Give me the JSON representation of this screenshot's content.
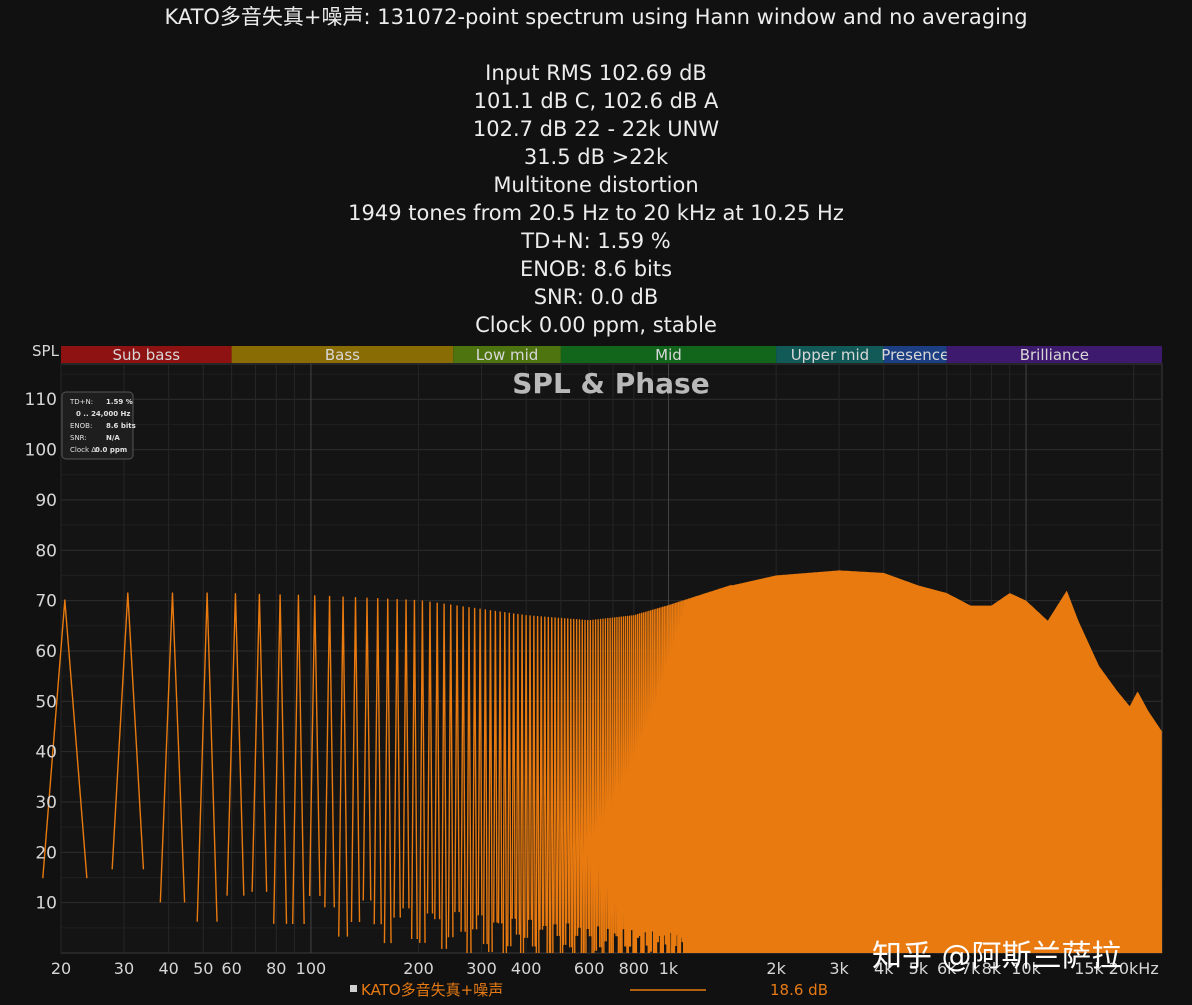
{
  "header": {
    "lines": [
      "KATO多音失真+噪声: 131072-point spectrum using Hann window and no averaging",
      "",
      "Input RMS 102.69 dB",
      "101.1 dB C, 102.6 dB A",
      "102.7 dB 22 - 22k UNW",
      "31.5 dB >22k",
      "Multitone distortion",
      "1949 tones from 20.5 Hz to 20 kHz at 10.25 Hz",
      "TD+N: 1.59 %",
      "ENOB: 8.6 bits",
      "SNR: 0.0 dB",
      "Clock 0.00 ppm, stable"
    ]
  },
  "chart_data": {
    "type": "line",
    "title": "SPL & Phase",
    "ylabel": "SPL",
    "xscale": "log",
    "xlim": [
      20,
      24000
    ],
    "ylim": [
      0,
      117
    ],
    "yticks": [
      10,
      20,
      30,
      40,
      50,
      60,
      70,
      80,
      90,
      100,
      110
    ],
    "xticks": [
      {
        "v": 20,
        "label": "20"
      },
      {
        "v": 30,
        "label": "30"
      },
      {
        "v": 40,
        "label": "40"
      },
      {
        "v": 50,
        "label": "50"
      },
      {
        "v": 60,
        "label": "60"
      },
      {
        "v": 80,
        "label": "80"
      },
      {
        "v": 100,
        "label": "100"
      },
      {
        "v": 200,
        "label": "200"
      },
      {
        "v": 300,
        "label": "300"
      },
      {
        "v": 400,
        "label": "400"
      },
      {
        "v": 600,
        "label": "600"
      },
      {
        "v": 800,
        "label": "800"
      },
      {
        "v": 1000,
        "label": "1k"
      },
      {
        "v": 2000,
        "label": "2k"
      },
      {
        "v": 3000,
        "label": "3k"
      },
      {
        "v": 4000,
        "label": "4k"
      },
      {
        "v": 5000,
        "label": "5k"
      },
      {
        "v": 6000,
        "label": "6k"
      },
      {
        "v": 7000,
        "label": "7k"
      },
      {
        "v": 8000,
        "label": "8k"
      },
      {
        "v": 10000,
        "label": "10k"
      },
      {
        "v": 15000,
        "label": "15k"
      },
      {
        "v": 20000,
        "label": "20kHz"
      }
    ],
    "bands": [
      {
        "name": "Sub bass",
        "from": 20,
        "to": 60,
        "color": "#8e1212"
      },
      {
        "name": "Bass",
        "from": 60,
        "to": 250,
        "color": "#8a6c05"
      },
      {
        "name": "Low mid",
        "from": 250,
        "to": 500,
        "color": "#4e7410"
      },
      {
        "name": "Mid",
        "from": 500,
        "to": 2000,
        "color": "#11661c"
      },
      {
        "name": "Upper mid",
        "from": 2000,
        "to": 4000,
        "color": "#115a58"
      },
      {
        "name": "Presence",
        "from": 4000,
        "to": 6000,
        "color": "#1c3e82"
      },
      {
        "name": "Brilliance",
        "from": 6000,
        "to": 24000,
        "color": "#3d1a6e"
      }
    ],
    "series": [
      {
        "name": "KATO多音失真+噪声",
        "color": "#e87a10",
        "tone_peaks": {
          "start_hz": 20.5,
          "step_hz": 10.25,
          "end_hz": 20000,
          "count": 1949
        },
        "envelope": [
          {
            "x": 20,
            "y": 70
          },
          {
            "x": 30,
            "y": 71.5
          },
          {
            "x": 50,
            "y": 71.5
          },
          {
            "x": 100,
            "y": 71
          },
          {
            "x": 200,
            "y": 70
          },
          {
            "x": 400,
            "y": 67
          },
          {
            "x": 600,
            "y": 66
          },
          {
            "x": 800,
            "y": 67
          },
          {
            "x": 1000,
            "y": 69
          },
          {
            "x": 1500,
            "y": 73
          },
          {
            "x": 2000,
            "y": 75
          },
          {
            "x": 3000,
            "y": 76
          },
          {
            "x": 4000,
            "y": 75.5
          },
          {
            "x": 5000,
            "y": 73
          },
          {
            "x": 6000,
            "y": 71.5
          },
          {
            "x": 7000,
            "y": 69
          },
          {
            "x": 8000,
            "y": 69
          },
          {
            "x": 9000,
            "y": 71.5
          },
          {
            "x": 10000,
            "y": 70
          },
          {
            "x": 11500,
            "y": 66
          },
          {
            "x": 13000,
            "y": 72
          },
          {
            "x": 14000,
            "y": 66
          },
          {
            "x": 16000,
            "y": 57
          },
          {
            "x": 18000,
            "y": 52
          },
          {
            "x": 19500,
            "y": 49
          },
          {
            "x": 20500,
            "y": 52
          },
          {
            "x": 22000,
            "y": 48
          },
          {
            "x": 24000,
            "y": 44
          }
        ],
        "floor": [
          {
            "x": 20,
            "y": 15
          },
          {
            "x": 50,
            "y": 10
          },
          {
            "x": 100,
            "y": 8
          },
          {
            "x": 200,
            "y": 5
          },
          {
            "x": 500,
            "y": 2
          },
          {
            "x": 1000,
            "y": 0
          },
          {
            "x": 24000,
            "y": 0
          }
        ],
        "fill_from_hz": 1500
      }
    ],
    "legend": {
      "name": "KATO多音失真+噪声",
      "value": "18.6 dB"
    },
    "inset": [
      {
        "label": "TD+N:",
        "value": "1.59 %"
      },
      {
        "label": "",
        "value": "0 .. 24,000 Hz"
      },
      {
        "label": "ENOB:",
        "value": "8.6 bits"
      },
      {
        "label": "SNR:",
        "value": "N/A"
      },
      {
        "label": "Clock Δ:",
        "value": "0.0 ppm"
      }
    ]
  },
  "watermark": "知乎 @阿斯兰萨拉",
  "colors": {
    "trace": "#e87a10",
    "background": "#111111",
    "grid": "#2c2c2c"
  }
}
